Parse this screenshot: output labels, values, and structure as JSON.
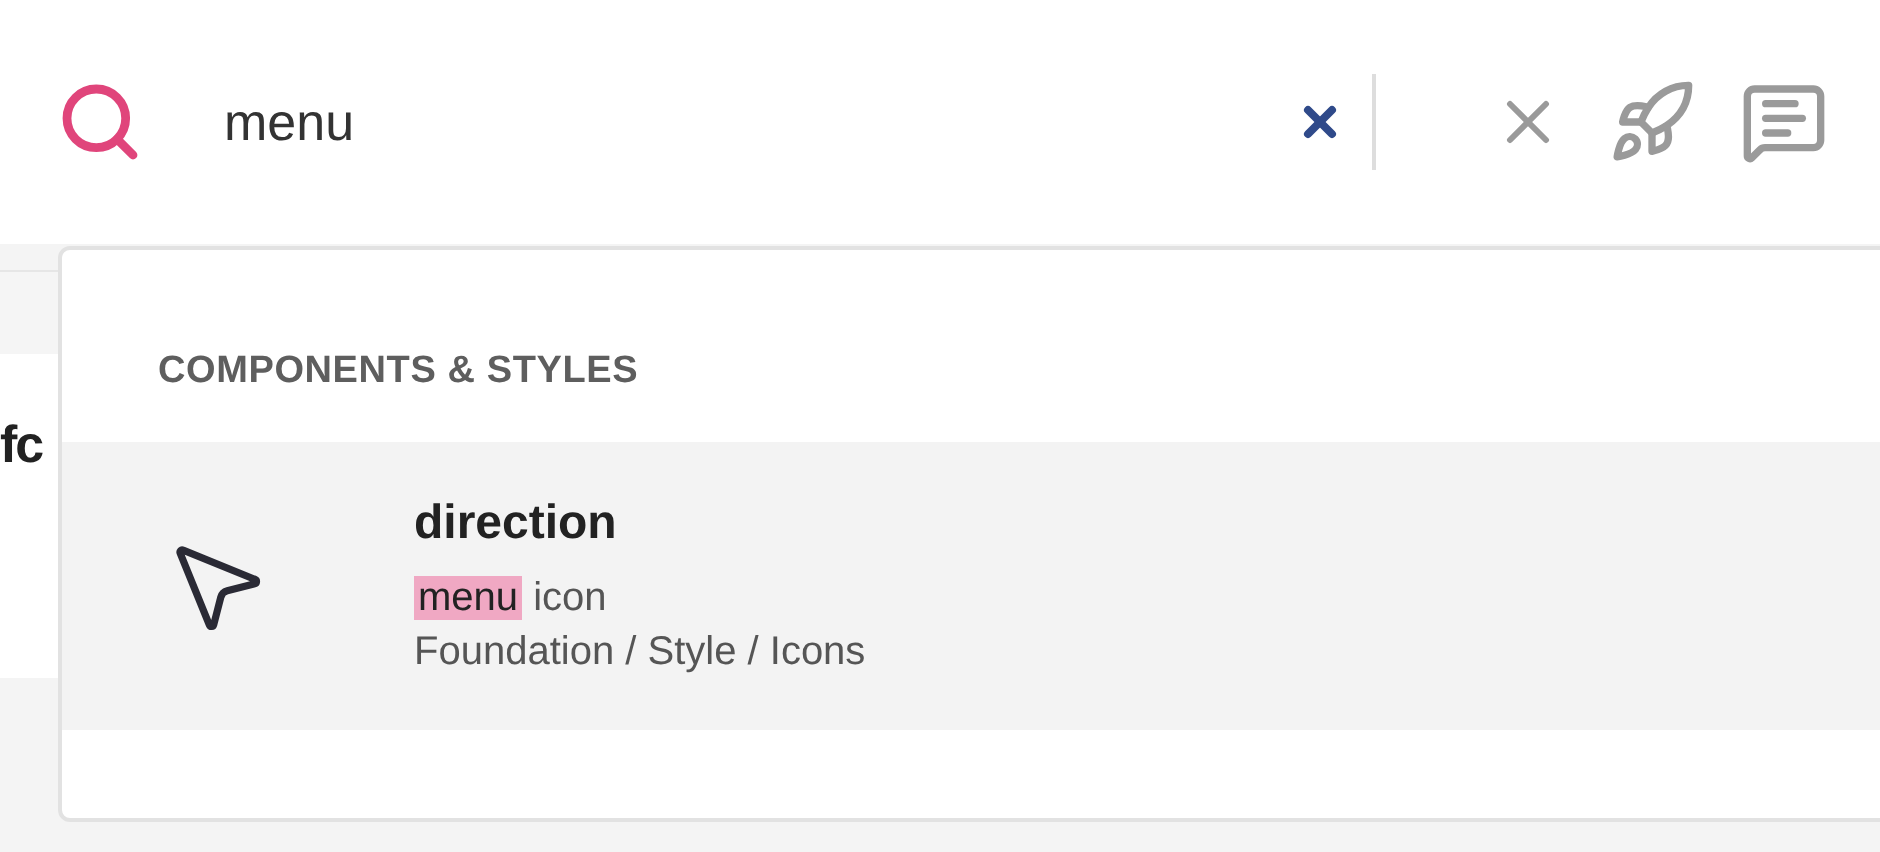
{
  "search": {
    "value": "menu"
  },
  "toolbar": [
    {
      "kind": "close"
    },
    {
      "kind": "rocket"
    },
    {
      "kind": "comment"
    }
  ],
  "background": {
    "text": "fc"
  },
  "dropdown": {
    "section": "COMPONENTS & STYLES",
    "results": [
      {
        "selected": true,
        "title": "direction",
        "description": [
          {
            "text": "menu",
            "highlighted": true
          },
          {
            "text": "icon",
            "highlighted": false
          }
        ],
        "path": "Foundation / Style / Icons"
      }
    ]
  }
}
